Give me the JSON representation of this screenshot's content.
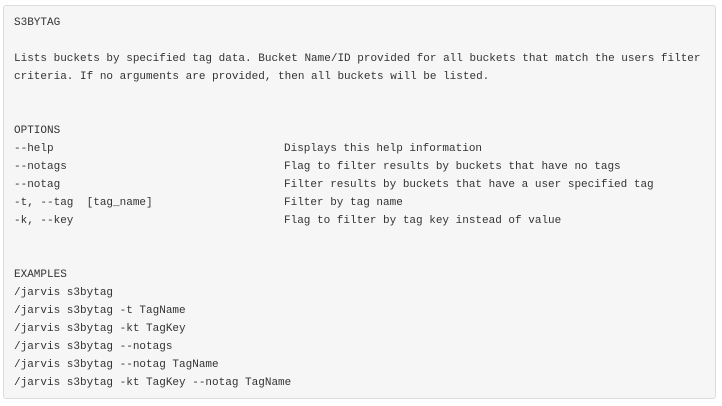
{
  "help_page": {
    "title": "S3BYTAG",
    "description": [
      "Lists buckets by specified tag data. Bucket Name/ID provided for all buckets that match the users filter",
      "criteria. If no arguments are provided, then all buckets will be listed."
    ],
    "options_heading": "OPTIONS",
    "options": [
      {
        "flag": "--help",
        "description": "Displays this help information"
      },
      {
        "flag": "--notags",
        "description": "Flag to filter results by buckets that have no tags"
      },
      {
        "flag": "--notag",
        "description": "Filter results by buckets that have a user specified tag"
      },
      {
        "flag": "-t, --tag  [tag_name]",
        "description": "Filter by tag name"
      },
      {
        "flag": "-k, --key",
        "description": "Flag to filter by tag key instead of value"
      }
    ],
    "examples_heading": "EXAMPLES",
    "examples": [
      "/jarvis s3bytag",
      "/jarvis s3bytag -t TagName",
      "/jarvis s3bytag -kt TagKey",
      "/jarvis s3bytag --notags",
      "/jarvis s3bytag --notag TagName",
      "/jarvis s3bytag -kt TagKey --notag TagName"
    ]
  }
}
